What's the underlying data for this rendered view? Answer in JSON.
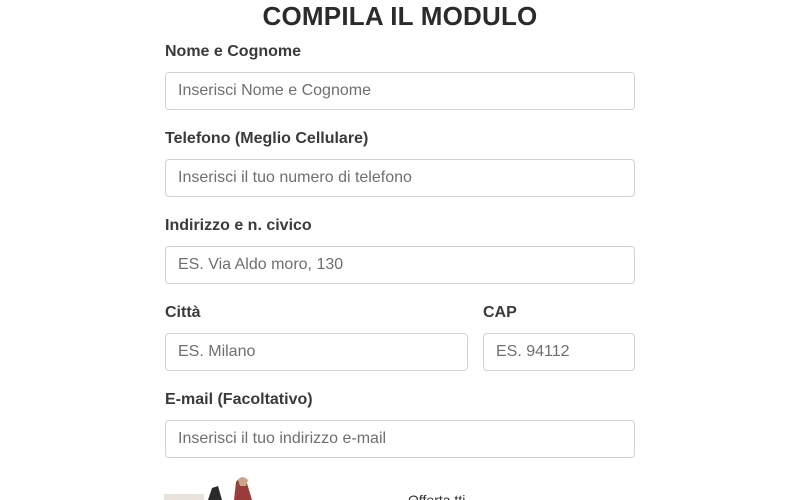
{
  "form": {
    "title": "COMPILA IL MODULO",
    "fields": {
      "name": {
        "label": "Nome e Cognome",
        "placeholder": "Inserisci Nome e Cognome",
        "value": ""
      },
      "phone": {
        "label": "Telefono (Meglio Cellulare)",
        "placeholder": "Inserisci il tuo numero di telefono",
        "value": ""
      },
      "address": {
        "label": "Indirizzo e n. civico",
        "placeholder": "ES. Via Aldo moro, 130",
        "value": ""
      },
      "city": {
        "label": "Città",
        "placeholder": "ES. Milano",
        "value": ""
      },
      "cap": {
        "label": "CAP",
        "placeholder": "ES. 94112",
        "value": ""
      },
      "email": {
        "label": "E-mail (Facoltativo)",
        "placeholder": "Inserisci il tuo indirizzo e-mail",
        "value": ""
      }
    }
  },
  "offer": {
    "text": "Offerta tti"
  },
  "colors": {
    "title": "#2b2b2b",
    "label": "#3a3a3a",
    "input_border": "#cfd3d7",
    "placeholder": "#6f6f6f"
  }
}
